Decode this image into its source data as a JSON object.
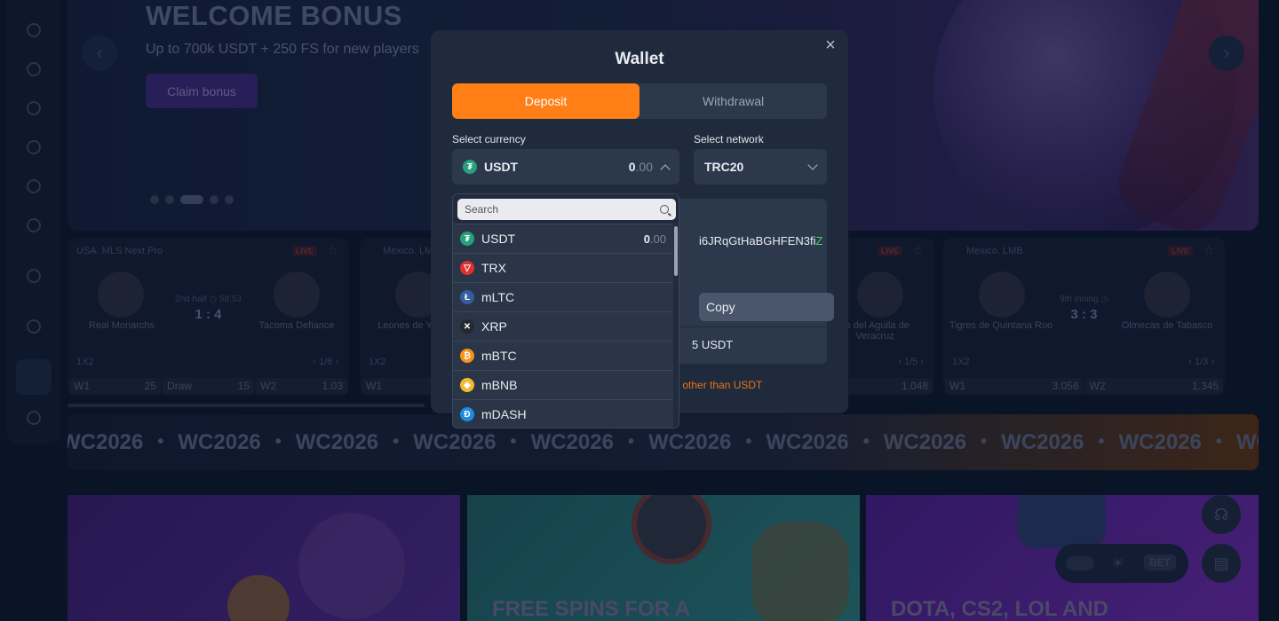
{
  "hero": {
    "title": "WELCOME BONUS",
    "subtitle": "Up to 700k USDT + 250 FS for new players",
    "cta": "Claim bonus",
    "prev": "‹",
    "next": "›"
  },
  "matches": [
    {
      "league": "USA. MLS Next Pro",
      "live": "LIVE",
      "home": "Real Monarchs",
      "away": "Tacoma Defiance",
      "status": "2nd half  ◷ 58:53",
      "score": "1 : 4",
      "market": "1X2",
      "pager": "‹  1/6  ›",
      "odds": [
        {
          "k": "W1",
          "v": "25"
        },
        {
          "k": "Draw",
          "v": "15"
        },
        {
          "k": "W2",
          "v": "1.03"
        }
      ]
    },
    {
      "league": "Mexico. LM",
      "live": "",
      "home": "Leones de Y",
      "away": "",
      "status": "",
      "score": "",
      "market": "1X2",
      "pager": "",
      "odds": [
        {
          "k": "W1",
          "v": ""
        }
      ]
    },
    {
      "league": "",
      "live": "LIVE",
      "home": "",
      "away": "os del Aguila de Veracruz",
      "status": "",
      "score": "",
      "market": "",
      "pager": "‹  1/5  ›",
      "odds": [
        {
          "k": "",
          "v": "1.048"
        }
      ]
    },
    {
      "league": "Mexico. LMB",
      "live": "LIVE",
      "home": "Tigres de Quintana Roo",
      "away": "Olmecas de Tabasco",
      "status": "9th inning  ◷",
      "score": "3 : 3",
      "market": "1X2",
      "pager": "‹  1/3  ›",
      "odds": [
        {
          "k": "W1",
          "v": "3.056"
        },
        {
          "k": "W2",
          "v": "1.345"
        }
      ]
    }
  ],
  "marquee": {
    "text": "WC2026",
    "bullet": "•",
    "partial_start": "WC2026"
  },
  "promos": [
    {
      "title": ""
    },
    {
      "title": "FREE SPINS FOR A"
    },
    {
      "title": "DOTA, CS2, LOL AND"
    }
  ],
  "bet_widget": {
    "label": "BET"
  },
  "wallet": {
    "title": "Wallet",
    "close": "×",
    "tabs": [
      {
        "label": "Deposit",
        "active": true
      },
      {
        "label": "Withdrawal",
        "active": false
      }
    ],
    "currency_label": "Select currency",
    "network_label": "Select network",
    "selected_currency": {
      "code": "USDT",
      "amount_int": "0",
      "amount_dec": ".00"
    },
    "selected_network": "TRC20",
    "address_tail": "i6JRqGtHaBGHFEN3fi",
    "address_last": "Z",
    "copy_label": "Copy",
    "min_deposit_tail": "5 USDT",
    "warning_tail": "nt other than USDT"
  },
  "currency_dropdown": {
    "search_placeholder": "Search",
    "items": [
      {
        "code": "USDT",
        "icon": "tether-icon",
        "glyph": "₮",
        "color": "#26a17b",
        "amount_int": "0",
        "amount_dec": ".00"
      },
      {
        "code": "TRX",
        "icon": "tron-icon",
        "glyph": "▽",
        "color": "#e0312f",
        "amount_int": "",
        "amount_dec": ""
      },
      {
        "code": "mLTC",
        "icon": "litecoin-icon",
        "glyph": "Ł",
        "color": "#345d9d",
        "amount_int": "",
        "amount_dec": ""
      },
      {
        "code": "XRP",
        "icon": "xrp-icon",
        "glyph": "✕",
        "color": "#23292f",
        "amount_int": "",
        "amount_dec": ""
      },
      {
        "code": "mBTC",
        "icon": "bitcoin-icon",
        "glyph": "₿",
        "color": "#f7931a",
        "amount_int": "",
        "amount_dec": ""
      },
      {
        "code": "mBNB",
        "icon": "bnb-icon",
        "glyph": "◆",
        "color": "#f3ba2f",
        "amount_int": "",
        "amount_dec": ""
      },
      {
        "code": "mDASH",
        "icon": "dash-icon",
        "glyph": "Đ",
        "color": "#1c8de0",
        "amount_int": "",
        "amount_dec": ""
      }
    ]
  },
  "colors": {
    "accent": "#ff7f16",
    "modal_bg": "#1f2a3c",
    "field_bg": "#2c384c",
    "warning": "#e8731a",
    "address_highlight": "#3ed65a"
  }
}
